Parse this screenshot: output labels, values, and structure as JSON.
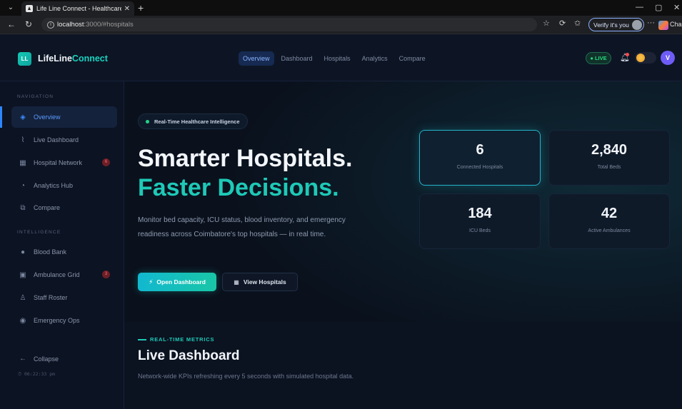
{
  "browser": {
    "tab_title": "Life Line Connect - Healthcare Inte",
    "tab_close": "✕",
    "new_tab": "+",
    "url_host": "localhost",
    "url_path": ":3000/#hospitals",
    "verify_label": "Verify it's you",
    "more": "···",
    "copilot_label": "Cha"
  },
  "header": {
    "logo_mark": "LL",
    "logo_main": "LifeLine",
    "logo_accent": "Connect",
    "nav": [
      "Overview",
      "Dashboard",
      "Hospitals",
      "Analytics",
      "Compare"
    ],
    "live_label": "● LIVE",
    "avatar_initial": "V"
  },
  "sidebar": {
    "section_navigation": "NAVIGATION",
    "section_intelligence": "INTELLIGENCE",
    "items": [
      {
        "label": "Overview",
        "icon": "layers-icon",
        "glyph": "◈"
      },
      {
        "label": "Live Dashboard",
        "icon": "chart-line-icon",
        "glyph": "⌇"
      },
      {
        "label": "Hospital Network",
        "icon": "hospital-icon",
        "glyph": "▦",
        "badge": "6"
      },
      {
        "label": "Analytics Hub",
        "icon": "analytics-icon",
        "glyph": "◔"
      },
      {
        "label": "Compare",
        "icon": "compare-icon",
        "glyph": "⧉"
      },
      {
        "label": "Blood Bank",
        "icon": "blood-drop-icon",
        "glyph": "●"
      },
      {
        "label": "Ambulance Grid",
        "icon": "ambulance-icon",
        "glyph": "▣",
        "badge": "3"
      },
      {
        "label": "Staff Roster",
        "icon": "staff-icon",
        "glyph": "♙"
      },
      {
        "label": "Emergency Ops",
        "icon": "emergency-pin-icon",
        "glyph": "◉"
      }
    ],
    "collapse_label": "Collapse",
    "clock": "⏱ 06:22:33 pm"
  },
  "hero": {
    "pill": "Real-Time Healthcare Intelligence",
    "line1": "Smarter Hospitals.",
    "line2": "Faster Decisions.",
    "description": "Monitor bed capacity, ICU status, blood inventory, and emergency readiness across Coimbatore's top hospitals — in real time.",
    "primary_button": "Open Dashboard",
    "secondary_button": "View Hospitals",
    "stats": [
      {
        "value": "6",
        "label": "Connected Hospitals"
      },
      {
        "value": "2,840",
        "label": "Total Beds"
      },
      {
        "value": "184",
        "label": "ICU Beds"
      },
      {
        "value": "42",
        "label": "Active Ambulances"
      }
    ]
  },
  "metrics": {
    "kicker": "REAL-TIME METRICS",
    "title": "Live Dashboard",
    "description": "Network-wide KPIs refreshing every 5 seconds with simulated hospital data."
  }
}
